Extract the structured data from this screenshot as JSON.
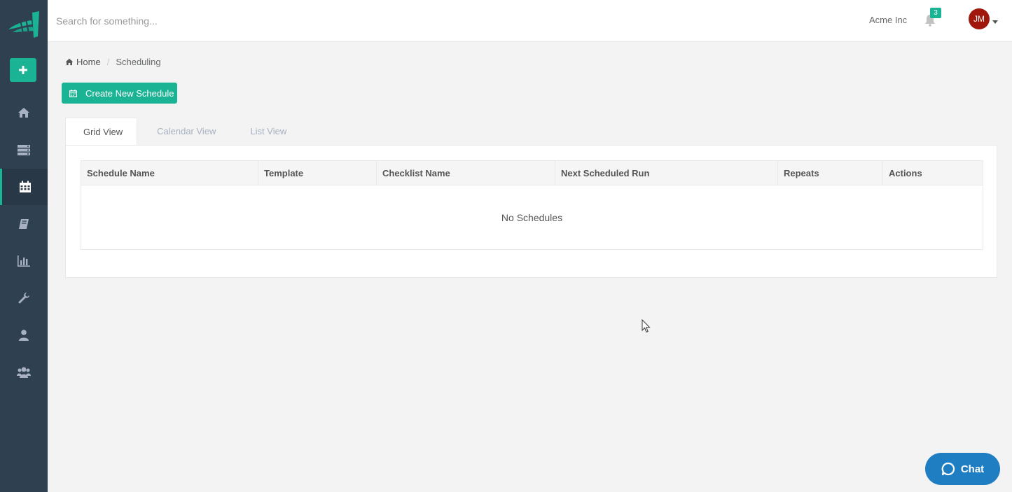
{
  "app": {
    "brand_color": "#1ab394",
    "sidebar_color": "#2f4050"
  },
  "sidebar": {
    "add_icon": "plus-icon",
    "items": [
      {
        "name": "home",
        "icon": "home-icon",
        "active": false
      },
      {
        "name": "data",
        "icon": "server-icon",
        "active": false
      },
      {
        "name": "scheduling",
        "icon": "calendar-icon",
        "active": true
      },
      {
        "name": "book",
        "icon": "book-icon",
        "active": false
      },
      {
        "name": "reports",
        "icon": "bar-chart-icon",
        "active": false
      },
      {
        "name": "tools",
        "icon": "wrench-icon",
        "active": false
      },
      {
        "name": "user",
        "icon": "user-icon",
        "active": false
      },
      {
        "name": "users",
        "icon": "users-icon",
        "active": false
      }
    ]
  },
  "topbar": {
    "search_placeholder": "Search for something...",
    "company": "Acme Inc",
    "notification_count": "3",
    "avatar_initials": "JM"
  },
  "breadcrumb": {
    "home": "Home",
    "current": "Scheduling"
  },
  "toolbar": {
    "create_label": "Create New Schedule"
  },
  "tabs": [
    {
      "label": "Grid View",
      "active": true
    },
    {
      "label": "Calendar View",
      "active": false
    },
    {
      "label": "List View",
      "active": false
    }
  ],
  "table": {
    "columns": [
      "Schedule Name",
      "Template",
      "Checklist Name",
      "Next Scheduled Run",
      "Repeats",
      "Actions"
    ],
    "empty_message": "No Schedules"
  },
  "chat": {
    "label": "Chat"
  }
}
